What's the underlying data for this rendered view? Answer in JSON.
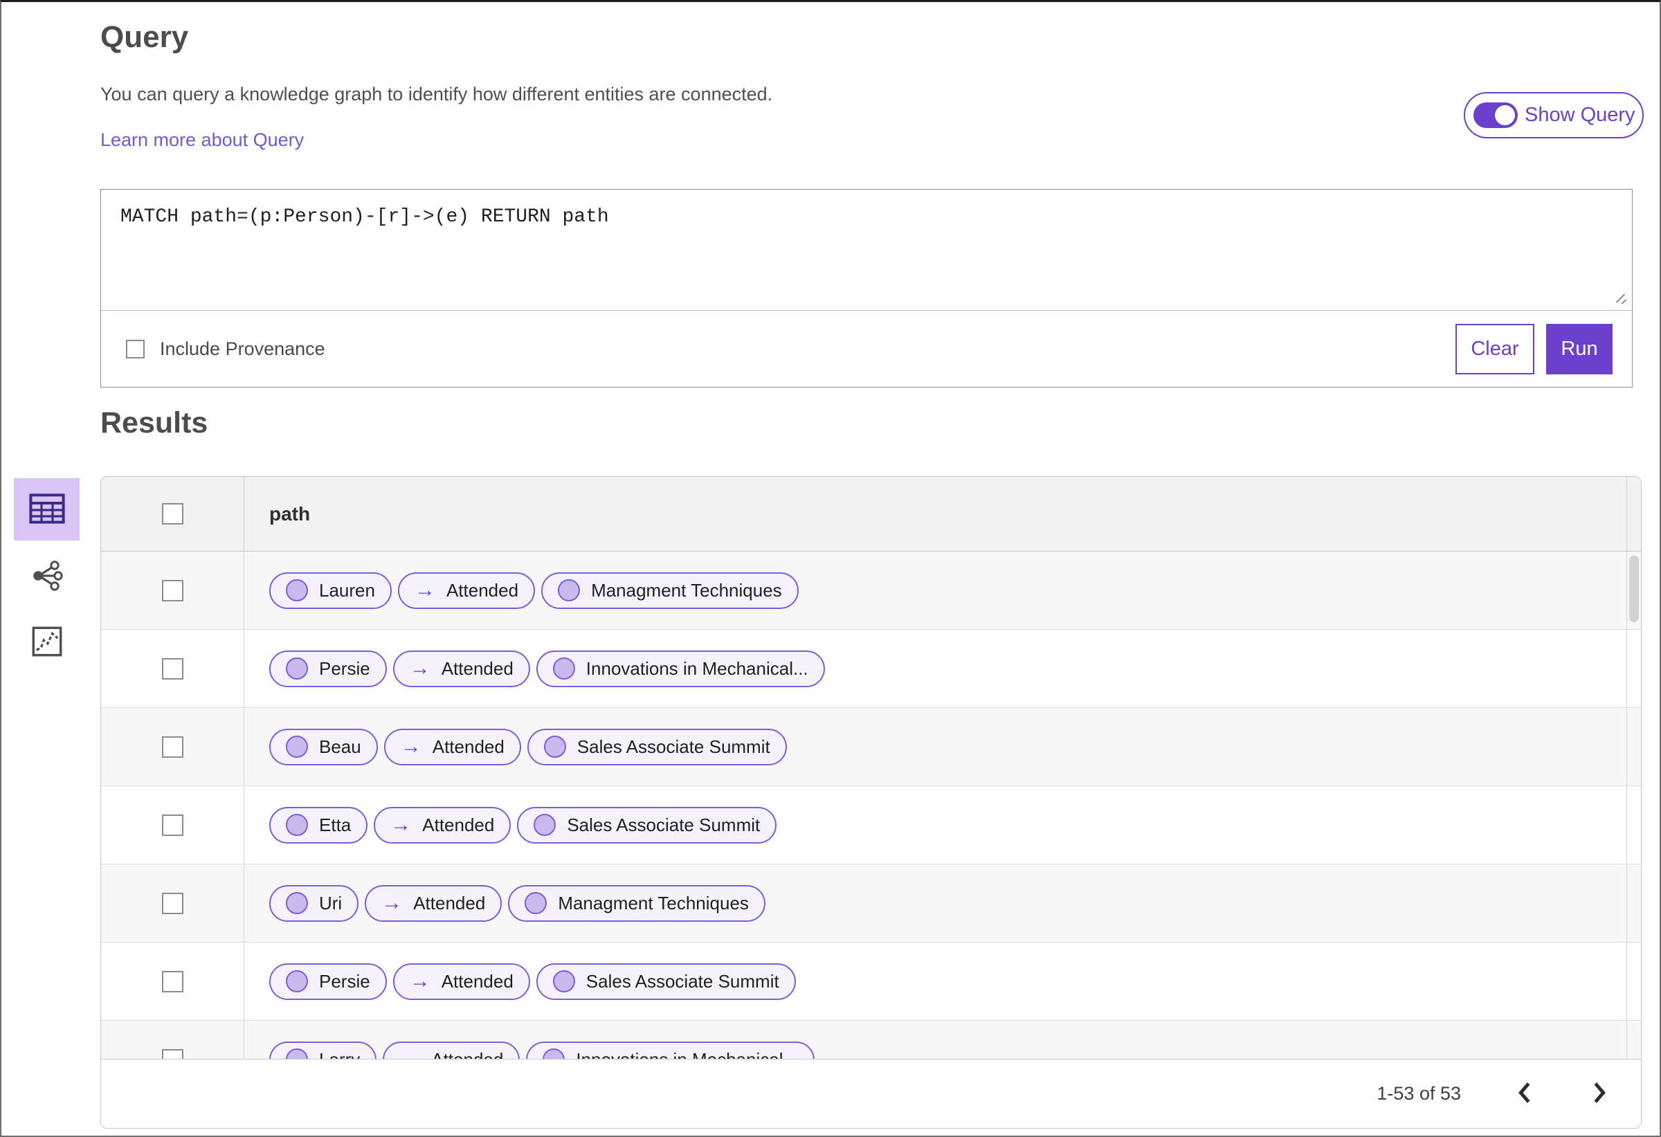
{
  "header": {
    "title": "Query",
    "description": "You can query a knowledge graph to identify how different entities are connected.",
    "learn_more_link": "Learn more about Query",
    "show_query_toggle": {
      "label": "Show Query",
      "state": "on"
    }
  },
  "query_editor": {
    "query_text": "MATCH path=(p:Person)-[r]->(e) RETURN path",
    "include_provenance": {
      "label": "Include Provenance",
      "checked": false
    },
    "clear_button": "Clear",
    "run_button": "Run"
  },
  "results": {
    "title": "Results",
    "view_switcher": [
      {
        "icon": "table-icon",
        "selected": true
      },
      {
        "icon": "network-graph-icon",
        "selected": false
      },
      {
        "icon": "chart-icon",
        "selected": false
      }
    ],
    "table": {
      "column_header": "path",
      "relation_arrow": "→",
      "rows": [
        {
          "source": "Lauren",
          "relation": "Attended",
          "target": "Managment Techniques"
        },
        {
          "source": "Persie",
          "relation": "Attended",
          "target": "Innovations in Mechanical..."
        },
        {
          "source": "Beau",
          "relation": "Attended",
          "target": "Sales Associate Summit"
        },
        {
          "source": "Etta",
          "relation": "Attended",
          "target": "Sales Associate Summit"
        },
        {
          "source": "Uri",
          "relation": "Attended",
          "target": "Managment Techniques"
        },
        {
          "source": "Persie",
          "relation": "Attended",
          "target": "Sales Associate Summit"
        },
        {
          "source": "Larry",
          "relation": "Attended",
          "target": "Innovations in Mechanical..."
        }
      ],
      "pagination": {
        "range_label": "1-53 of 53",
        "prev_icon": "chevron-left-icon",
        "next_icon": "chevron-right-icon"
      }
    }
  },
  "colors": {
    "accent": "#6b40cc",
    "pill_border": "#7c5ce0",
    "pill_bg": "#f5f2fc",
    "node_fill": "#c9b9ec",
    "selected_view_bg": "#d9c6f6",
    "selected_view_icon": "#3b2a8e",
    "link": "#7459d6"
  }
}
